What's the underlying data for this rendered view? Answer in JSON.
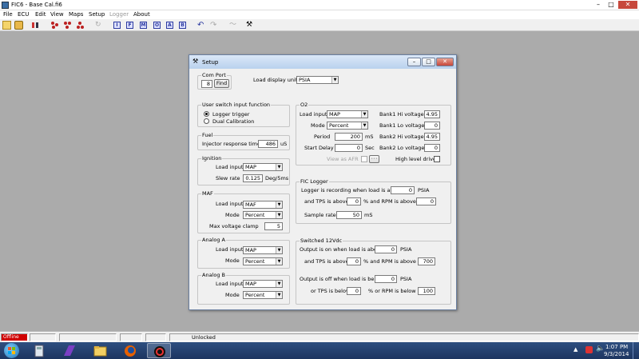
{
  "window": {
    "title": "FIC6 - Base Cal.fi6"
  },
  "menu": {
    "file": "File",
    "ecu": "ECU",
    "edit": "Edit",
    "view": "View",
    "maps": "Maps",
    "setup": "Setup",
    "logger": "Logger",
    "about": "About"
  },
  "toolbar": {
    "letters": [
      "I",
      "F",
      "M",
      "O",
      "A",
      "B"
    ]
  },
  "dialog": {
    "title": "Setup",
    "com_port": {
      "label": "Com Port",
      "value": "8",
      "find": "Find"
    },
    "load_display_units": {
      "label": "Load display units",
      "value": "PSIA"
    },
    "user_switch": {
      "label": "User switch input function",
      "opt1": "Logger trigger",
      "opt2": "Dual Calibration"
    },
    "fuel": {
      "label": "Fuel",
      "injector_label": "Injector response time",
      "injector_value": "486",
      "unit": "uS"
    },
    "ignition": {
      "label": "Ignition",
      "load_input_label": "Load input",
      "load_input": "MAP",
      "slew_label": "Slew rate",
      "slew_value": "0.125",
      "slew_unit": "Deg/5ms"
    },
    "maf": {
      "label": "MAF",
      "load_input_label": "Load input",
      "load_input": "MAF",
      "mode_label": "Mode",
      "mode": "Percent",
      "clamp_label": "Max voltage clamp",
      "clamp_value": "5"
    },
    "analog_a": {
      "label": "Analog A",
      "load_input_label": "Load input",
      "load_input": "MAP",
      "mode_label": "Mode",
      "mode": "Percent"
    },
    "analog_b": {
      "label": "Analog B",
      "load_input_label": "Load input",
      "load_input": "MAP",
      "mode_label": "Mode",
      "mode": "Percent"
    },
    "o2": {
      "label": "O2",
      "load_input_label": "Load input",
      "load_input": "MAP",
      "mode_label": "Mode",
      "mode": "Percent",
      "period_label": "Period",
      "period_value": "200",
      "period_unit": "mS",
      "start_delay_label": "Start Delay",
      "start_delay_value": "0",
      "start_delay_unit": "Sec",
      "b1hi_label": "Bank1 Hi voltage",
      "b1hi": "4.95",
      "b1lo_label": "Bank1 Lo voltage",
      "b1lo": "0",
      "b2hi_label": "Bank2 Hi voltage",
      "b2hi": "4.95",
      "b2lo_label": "Bank2 Lo voltage",
      "b2lo": "0",
      "view_afr": "View as AFR",
      "high_level_drive": "High level drive"
    },
    "fic_logger": {
      "label": "FIC Logger",
      "recording_label": "Logger is recording when load is above",
      "recording_value": "0",
      "recording_unit": "PSIA",
      "tps_label": "and TPS is above",
      "tps_value": "0",
      "rpm_label": "% and RPM is above",
      "rpm_value": "0",
      "sample_label": "Sample rate",
      "sample_value": "50",
      "sample_unit": "mS"
    },
    "switched": {
      "label": "Switched 12Vdc",
      "on_label": "Output is on when load is above",
      "on_value": "0",
      "on_unit": "PSIA",
      "on_tps_label": "and TPS is above",
      "on_tps": "0",
      "on_rpm_label": "% and RPM is above",
      "on_rpm": "700",
      "off_label": "Output is off when load is below",
      "off_value": "0",
      "off_unit": "PSIA",
      "off_tps_label": "or TPS is below",
      "off_tps": "0",
      "off_rpm_label": "% or RPM is below",
      "off_rpm": "100"
    }
  },
  "statusbar": {
    "offline": "Offline",
    "unlocked": "Unlocked"
  },
  "taskbar": {
    "time": "1:07 PM",
    "date": "9/3/2014"
  }
}
